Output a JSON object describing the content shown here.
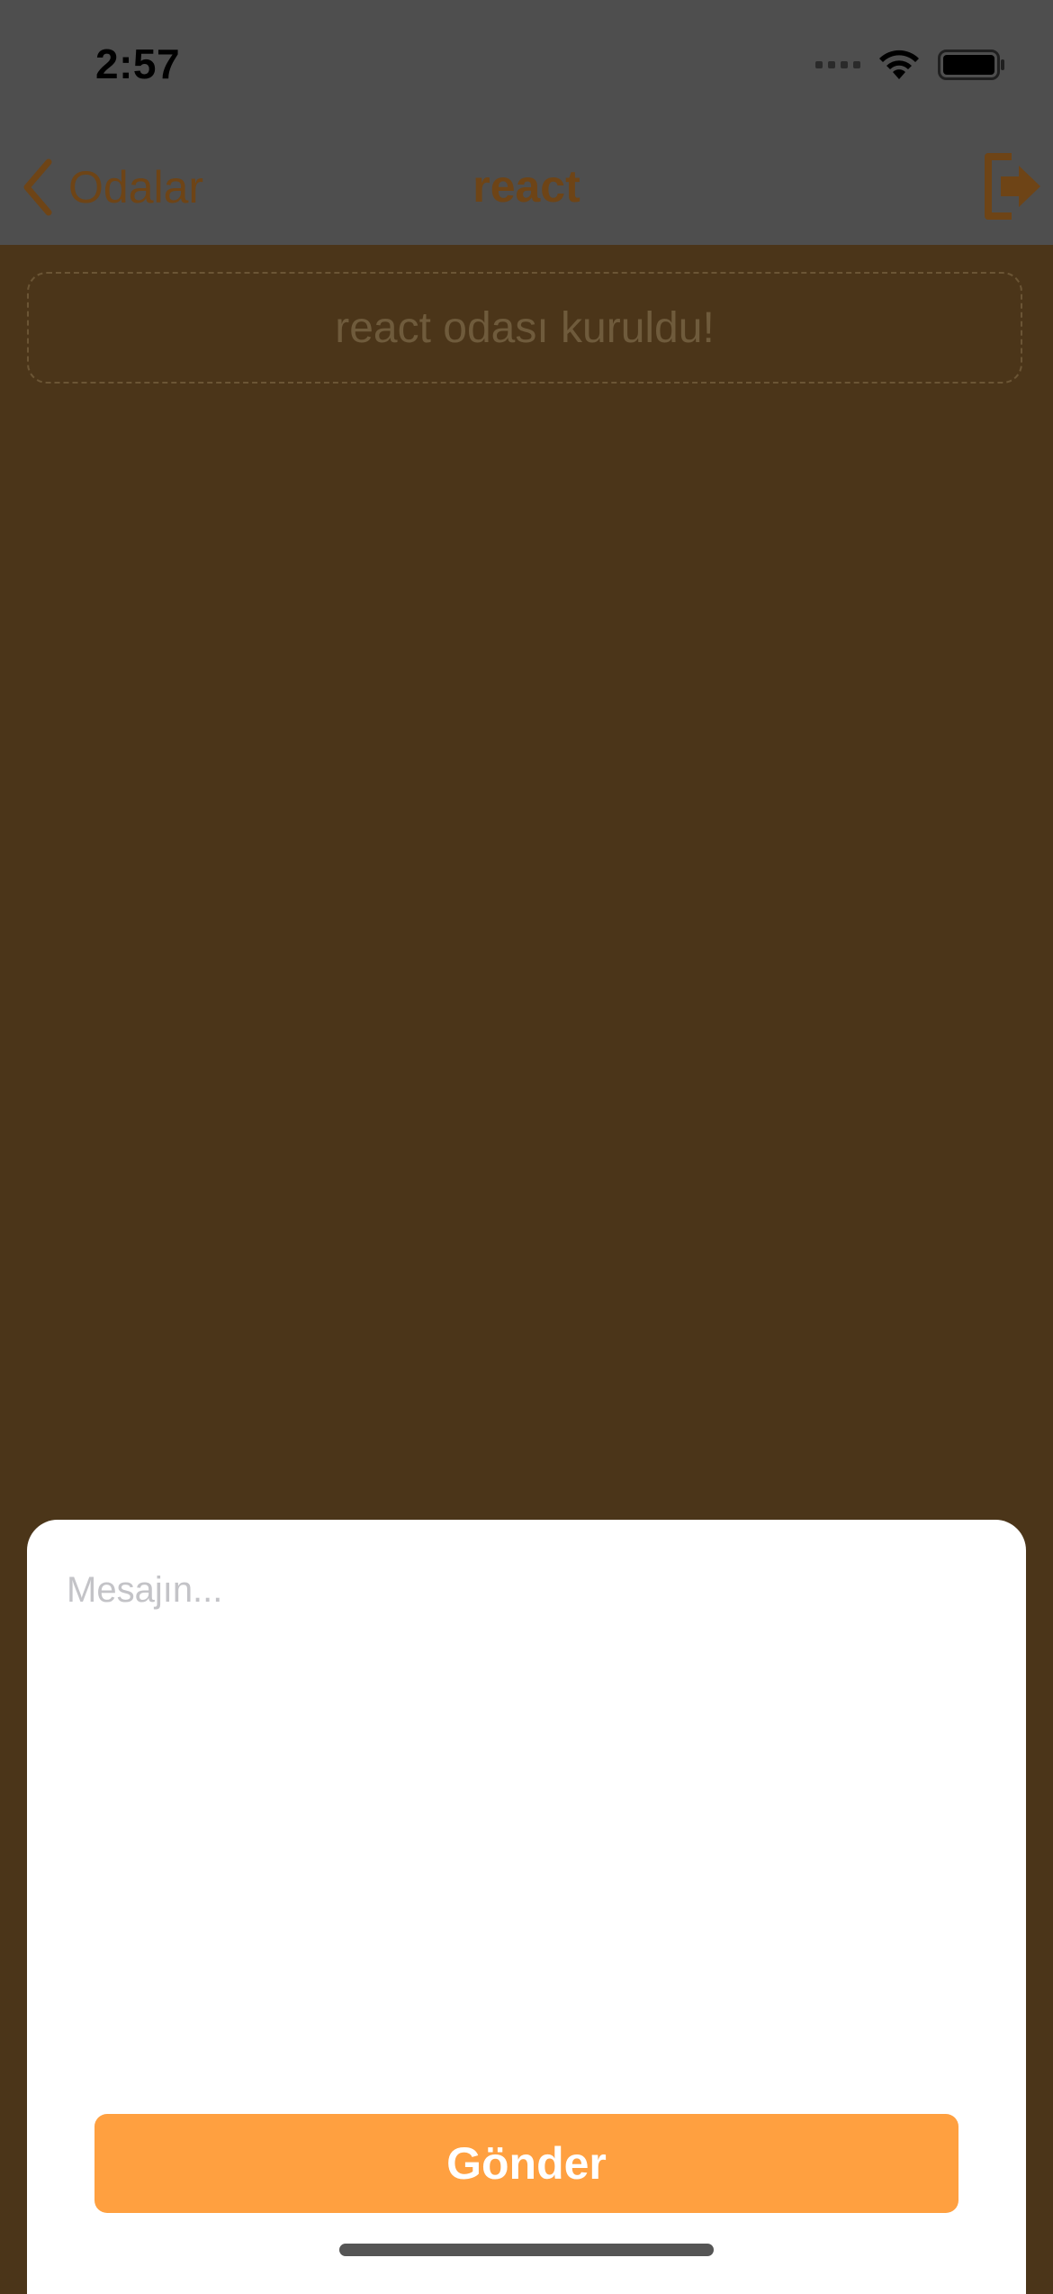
{
  "status_bar": {
    "time": "2:57",
    "icons": [
      "cellular-signal-icon",
      "wifi-icon",
      "battery-icon"
    ]
  },
  "nav": {
    "back_label": "Odalar",
    "title": "react",
    "back_icon": "chevron-left-icon",
    "exit_icon": "sign-out-icon"
  },
  "chat": {
    "system_message": "react odası kuruldu!"
  },
  "composer": {
    "placeholder": "Mesajın...",
    "value": "",
    "send_label": "Gönder"
  },
  "colors": {
    "accent": "#ffa040",
    "nav_text": "#6e4416",
    "overlay_background": "#4b3519",
    "bar_background": "#4e4e4e"
  }
}
